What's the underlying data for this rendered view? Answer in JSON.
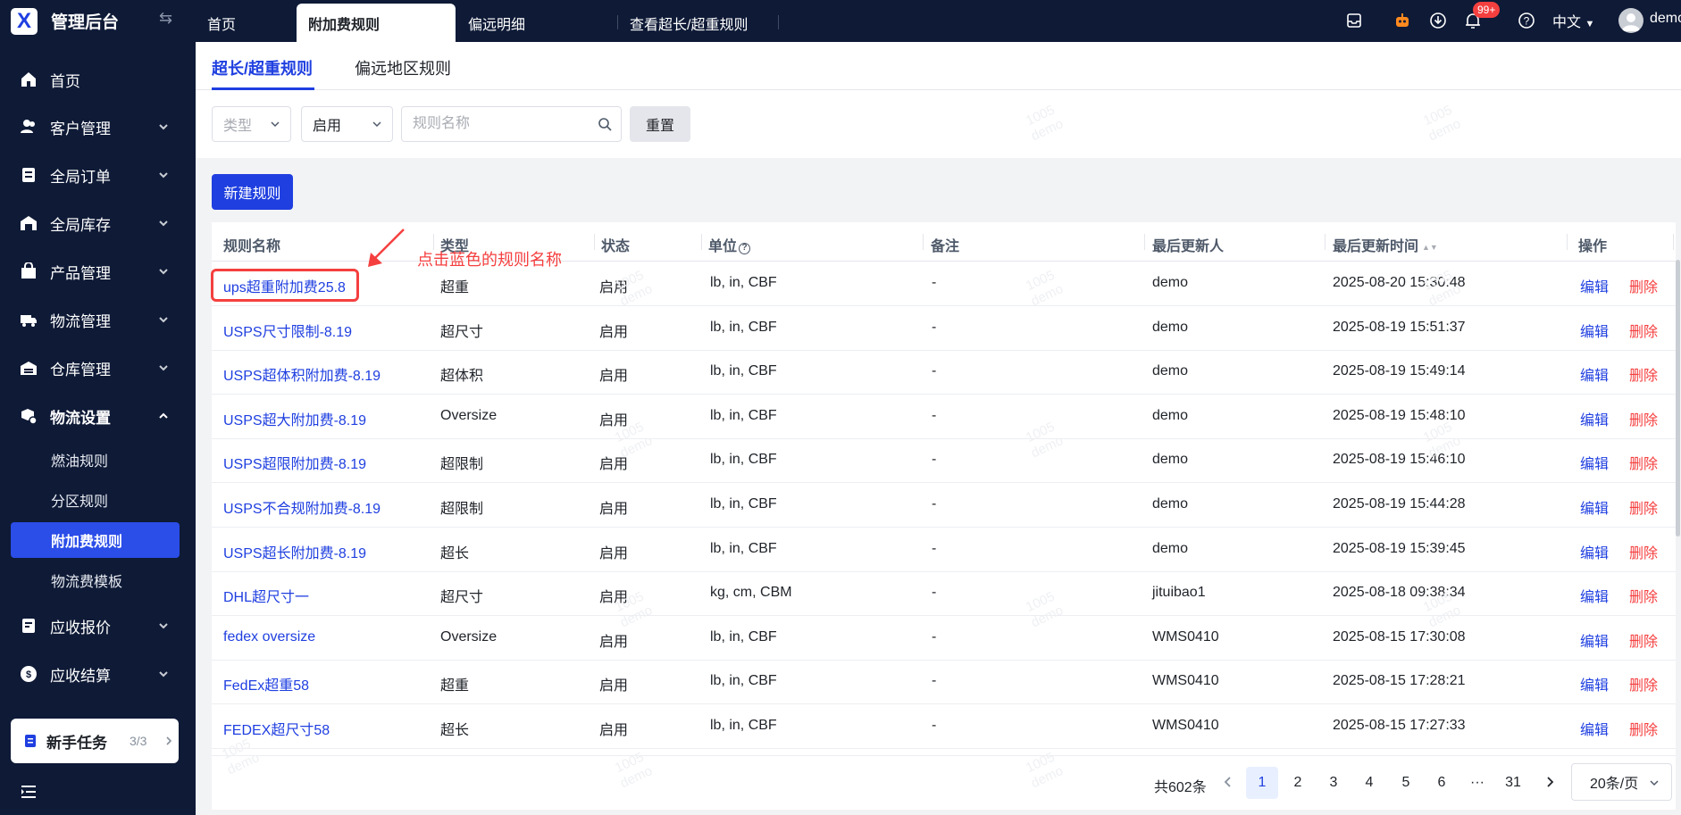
{
  "app": {
    "title": "管理后台",
    "logo_glyph": "X"
  },
  "topbar": {
    "tabs": [
      {
        "label": "首页"
      },
      {
        "label": "附加费规则"
      },
      {
        "label": "偏远明细"
      },
      {
        "label": "查看超长/超重规则"
      }
    ],
    "active_tab": 1,
    "notification_badge": "99+",
    "language": "中文",
    "user_name": "demo",
    "icons": [
      "message-icon",
      "robot-icon",
      "download-icon",
      "bell-icon",
      "help-icon"
    ]
  },
  "sidebar": {
    "menu": [
      {
        "label": "首页",
        "icon": "home-icon",
        "has_children": false
      },
      {
        "label": "客户管理",
        "icon": "users-icon",
        "has_children": true
      },
      {
        "label": "全局订单",
        "icon": "orders-icon",
        "has_children": true
      },
      {
        "label": "全局库存",
        "icon": "inventory-icon",
        "has_children": true
      },
      {
        "label": "产品管理",
        "icon": "product-icon",
        "has_children": true
      },
      {
        "label": "物流管理",
        "icon": "truck-icon",
        "has_children": true
      },
      {
        "label": "仓库管理",
        "icon": "warehouse-icon",
        "has_children": true
      },
      {
        "label": "物流设置",
        "icon": "logistics-settings-icon",
        "has_children": true,
        "expanded": true
      },
      {
        "label": "应收报价",
        "icon": "quote-icon",
        "has_children": true
      },
      {
        "label": "应收结算",
        "icon": "settlement-icon",
        "has_children": true
      }
    ],
    "submenu": [
      {
        "label": "燃油规则"
      },
      {
        "label": "分区规则"
      },
      {
        "label": "附加费规则",
        "active": true
      },
      {
        "label": "物流费模板"
      }
    ],
    "task": {
      "label": "新手任务",
      "count": "3/3"
    }
  },
  "subtabs": [
    {
      "label": "超长/超重规则",
      "active": true
    },
    {
      "label": "偏远地区规则"
    }
  ],
  "filters": {
    "type_placeholder": "类型",
    "status_value": "启用",
    "name_placeholder": "规则名称",
    "reset_label": "重置"
  },
  "new_rule_label": "新建规则",
  "table": {
    "headers": [
      "规则名称",
      "类型",
      "状态",
      "单位",
      "备注",
      "最后更新人",
      "最后更新时间",
      "操作"
    ],
    "edit_label": "编辑",
    "delete_label": "删除",
    "rows": [
      {
        "name": "ups超重附加费25.8",
        "type": "超重",
        "status": "启用",
        "unit": "lb, in, CBF",
        "note": "-",
        "updater": "demo",
        "time": "2025-08-20 15:30:48"
      },
      {
        "name": "USPS尺寸限制-8.19",
        "type": "超尺寸",
        "status": "启用",
        "unit": "lb, in, CBF",
        "note": "-",
        "updater": "demo",
        "time": "2025-08-19 15:51:37"
      },
      {
        "name": "USPS超体积附加费-8.19",
        "type": "超体积",
        "status": "启用",
        "unit": "lb, in, CBF",
        "note": "-",
        "updater": "demo",
        "time": "2025-08-19 15:49:14"
      },
      {
        "name": "USPS超大附加费-8.19",
        "type": "Oversize",
        "status": "启用",
        "unit": "lb, in, CBF",
        "note": "-",
        "updater": "demo",
        "time": "2025-08-19 15:48:10"
      },
      {
        "name": "USPS超限附加费-8.19",
        "type": "超限制",
        "status": "启用",
        "unit": "lb, in, CBF",
        "note": "-",
        "updater": "demo",
        "time": "2025-08-19 15:46:10"
      },
      {
        "name": "USPS不合规附加费-8.19",
        "type": "超限制",
        "status": "启用",
        "unit": "lb, in, CBF",
        "note": "-",
        "updater": "demo",
        "time": "2025-08-19 15:44:28"
      },
      {
        "name": "USPS超长附加费-8.19",
        "type": "超长",
        "status": "启用",
        "unit": "lb, in, CBF",
        "note": "-",
        "updater": "demo",
        "time": "2025-08-19 15:39:45"
      },
      {
        "name": "DHL超尺寸一",
        "type": "超尺寸",
        "status": "启用",
        "unit": "kg, cm, CBM",
        "note": "-",
        "updater": "jituibao1",
        "time": "2025-08-18 09:38:34"
      },
      {
        "name": "fedex oversize",
        "type": "Oversize",
        "status": "启用",
        "unit": "lb, in, CBF",
        "note": "-",
        "updater": "WMS0410",
        "time": "2025-08-15 17:30:08"
      },
      {
        "name": "FedEx超重58",
        "type": "超重",
        "status": "启用",
        "unit": "lb, in, CBF",
        "note": "-",
        "updater": "WMS0410",
        "time": "2025-08-15 17:28:21"
      },
      {
        "name": "FEDEX超尺寸58",
        "type": "超长",
        "status": "启用",
        "unit": "lb, in, CBF",
        "note": "-",
        "updater": "WMS0410",
        "time": "2025-08-15 17:27:33"
      }
    ]
  },
  "annotation": "点击蓝色的规则名称",
  "pagination": {
    "total": "共602条",
    "pages": [
      "1",
      "2",
      "3",
      "4",
      "5",
      "6",
      "···",
      "31"
    ],
    "current": "1",
    "page_size": "20条/页"
  },
  "watermark": {
    "line1": "1005",
    "line2": "demo"
  },
  "colors": {
    "sidebar_bg": "#0e1a36",
    "accent": "#1f3fe0",
    "danger": "#f53f3f"
  }
}
